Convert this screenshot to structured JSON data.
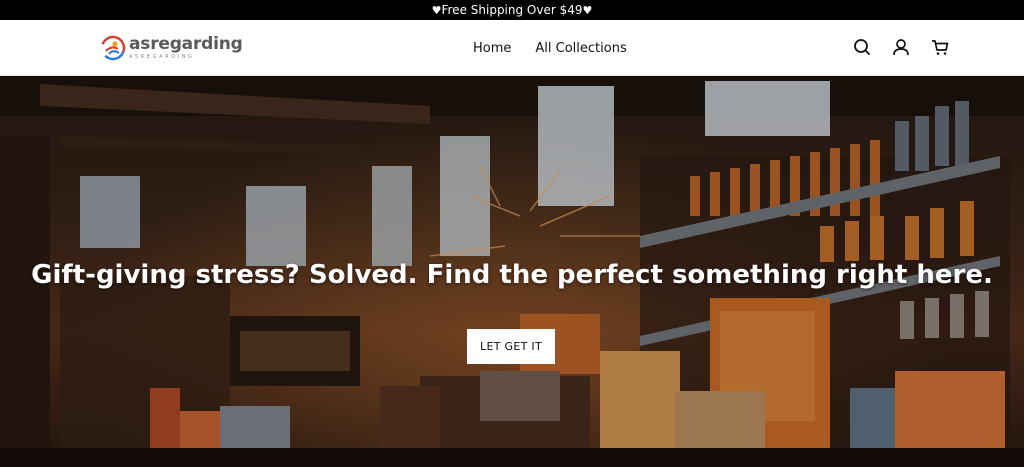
{
  "announcement": {
    "heart_icon": "white-heart",
    "text": "Free Shipping Over $49"
  },
  "header": {
    "logo_text": "asregarding",
    "logo_subtext": "ASREGARDING",
    "nav": [
      {
        "label": "Home"
      },
      {
        "label": "All Collections"
      }
    ],
    "icons": [
      "search-icon",
      "account-icon",
      "cart-icon"
    ]
  },
  "hero": {
    "headline": "Gift-giving stress? Solved. Find the perfect something right here.",
    "cta_label": "LET GET IT"
  },
  "colors": {
    "announcement_bg": "#000000",
    "header_bg": "#ffffff",
    "cta_bg": "#ffffff",
    "hero_text": "#ffffff"
  }
}
